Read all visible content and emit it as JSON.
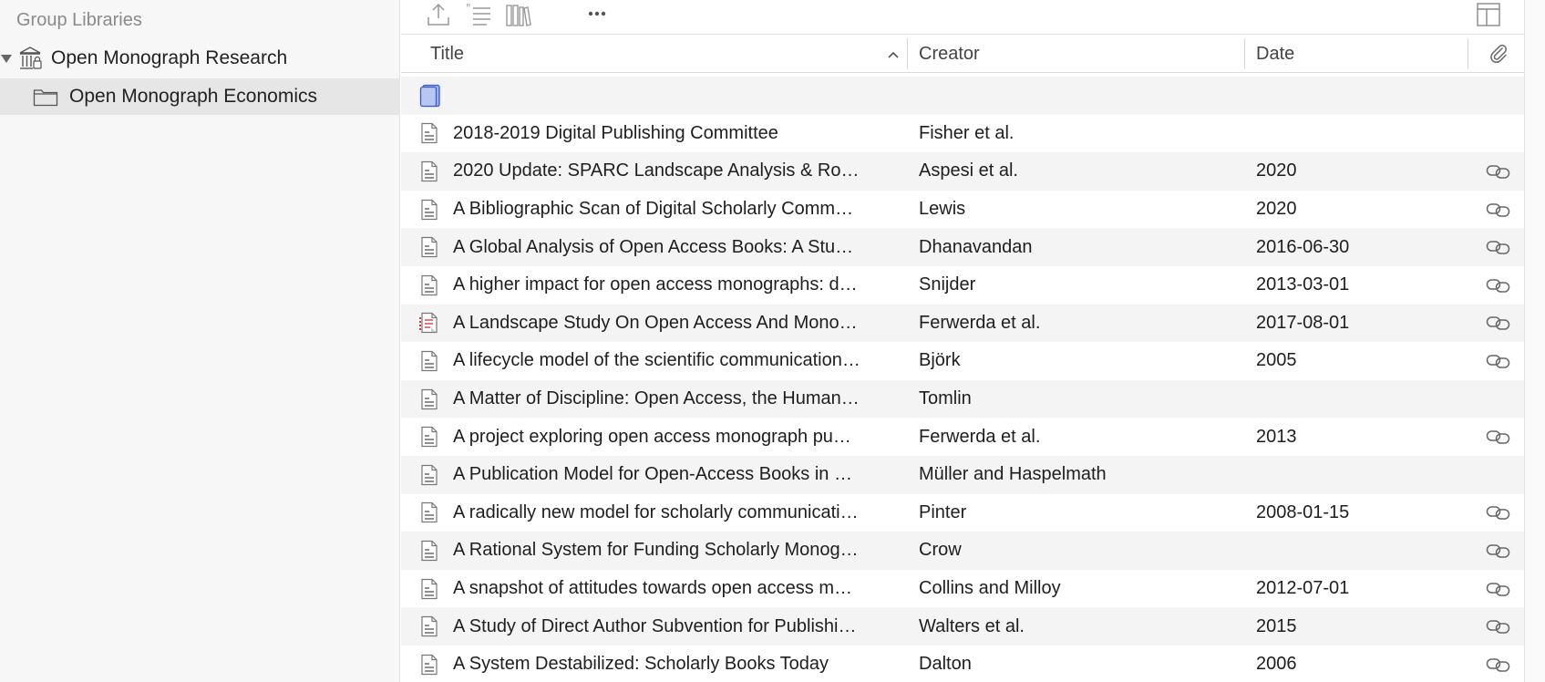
{
  "sidebar": {
    "heading": "Group Libraries",
    "group": {
      "label": "Open Monograph Research",
      "icon": "library-icon"
    },
    "collection": {
      "label": "Open Monograph Economics",
      "icon": "folder-icon"
    }
  },
  "toolbar": {
    "icons": [
      "export-icon",
      "create-bibliography-icon",
      "library-lookup-icon",
      "more-icon",
      "column-picker-icon"
    ]
  },
  "columns": {
    "title": "Title",
    "creator": "Creator",
    "date": "Date",
    "attachment_icon": "paperclip-icon"
  },
  "items": [
    {
      "type": "book",
      "icon": "book-icon",
      "title": "",
      "creator": "",
      "date": "",
      "link": false
    },
    {
      "type": "document",
      "icon": "document-icon",
      "title": "2018-2019 Digital Publishing Committee",
      "creator": "Fisher et al.",
      "date": "",
      "link": false
    },
    {
      "type": "document",
      "icon": "document-icon",
      "title": "2020 Update: SPARC Landscape Analysis & Ro…",
      "creator": "Aspesi et al.",
      "date": "2020",
      "link": true
    },
    {
      "type": "document",
      "icon": "document-icon",
      "title": "A Bibliographic Scan of Digital Scholarly Comm…",
      "creator": "Lewis",
      "date": "2020",
      "link": true
    },
    {
      "type": "document",
      "icon": "document-icon",
      "title": "A Global Analysis of Open Access Books: A Stu…",
      "creator": "Dhanavandan",
      "date": "2016-06-30",
      "link": true
    },
    {
      "type": "document",
      "icon": "document-icon",
      "title": "A higher impact for open access monographs: d…",
      "creator": "Snijder",
      "date": "2013-03-01",
      "link": true
    },
    {
      "type": "report",
      "icon": "report-icon",
      "title": "A Landscape Study On Open Access And Mono…",
      "creator": "Ferwerda et al.",
      "date": "2017-08-01",
      "link": true
    },
    {
      "type": "document",
      "icon": "document-icon",
      "title": "A lifecycle model of the scientific communication…",
      "creator": "Björk",
      "date": "2005",
      "link": true
    },
    {
      "type": "document",
      "icon": "document-icon",
      "title": "A Matter of Discipline: Open Access, the Human…",
      "creator": "Tomlin",
      "date": "",
      "link": false
    },
    {
      "type": "document",
      "icon": "document-icon",
      "title": "A project exploring open access monograph pu…",
      "creator": "Ferwerda et al.",
      "date": "2013",
      "link": true
    },
    {
      "type": "document",
      "icon": "document-icon",
      "title": "A Publication Model for Open-Access Books in …",
      "creator": "Müller and Haspelmath",
      "date": "",
      "link": false
    },
    {
      "type": "document",
      "icon": "document-icon",
      "title": "A radically new model for scholarly communicati…",
      "creator": "Pinter",
      "date": "2008-01-15",
      "link": true
    },
    {
      "type": "document",
      "icon": "document-icon",
      "title": "A Rational System for Funding Scholarly Monog…",
      "creator": "Crow",
      "date": "",
      "link": true
    },
    {
      "type": "document",
      "icon": "document-icon",
      "title": "A snapshot of attitudes towards open access m…",
      "creator": "Collins and Milloy",
      "date": "2012-07-01",
      "link": true
    },
    {
      "type": "document",
      "icon": "document-icon",
      "title": "A Study of Direct Author Subvention for Publishi…",
      "creator": "Walters et al.",
      "date": "2015",
      "link": true
    },
    {
      "type": "document",
      "icon": "document-icon",
      "title": "A System Destabilized: Scholarly Books Today",
      "creator": "Dalton",
      "date": "2006",
      "link": true
    }
  ]
}
